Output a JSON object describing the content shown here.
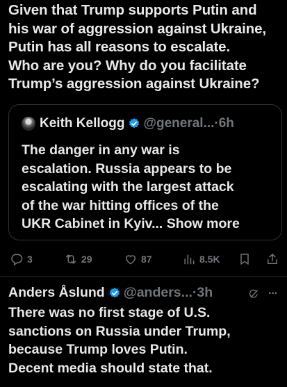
{
  "post": {
    "text": "Given that Trump supports Putin and\nhis war of aggression against Ukraine,\nPutin has all reasons to escalate.\nWho are you? Why do you facilitate\nTrump’s aggression against Ukraine?"
  },
  "quote": {
    "author_name": "Keith Kellogg",
    "handle": "@general...",
    "separator": "·",
    "time": "6h",
    "text": "The danger in any war is\nescalation. Russia appears to be\nescalating with the largest attack\nof the war hitting offices of the\nUKR Cabinet in Kyiv...",
    "show_more": "Show more"
  },
  "actions": {
    "replies": "3",
    "reposts": "29",
    "likes": "87",
    "views": "8.5K"
  },
  "reply": {
    "author_name": "Anders Åslund",
    "handle": "@anders...",
    "separator": "·",
    "time": "3h",
    "more": "···",
    "text": "There was no first stage of U.S.\nsanctions on Russia under Trump,\nbecause Trump loves Putin.\nDecent media should state that."
  },
  "colors": {
    "background": "#000000",
    "text": "#e7e9ea",
    "muted": "#71767b",
    "verified": "#1d9bf0",
    "border": "#2f3336"
  }
}
